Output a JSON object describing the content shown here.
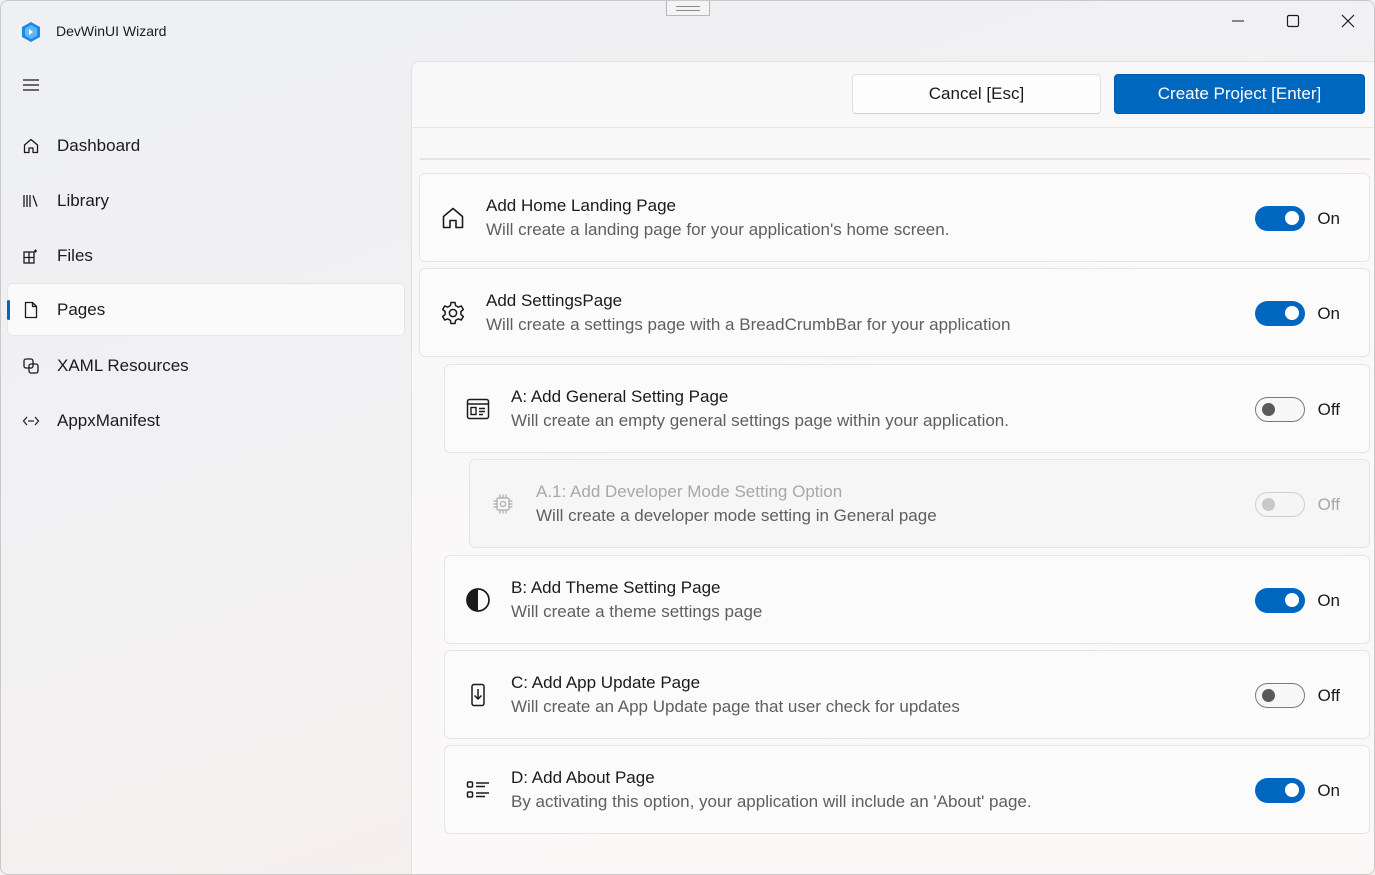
{
  "app": {
    "title": "DevWinUI Wizard",
    "accent": "#0067c0"
  },
  "sidebar": {
    "menu_icon": "hamburger-icon",
    "items": [
      {
        "label": "Dashboard",
        "icon": "home-icon",
        "selected": false
      },
      {
        "label": "Library",
        "icon": "library-icon",
        "selected": false
      },
      {
        "label": "Files",
        "icon": "files-icon",
        "selected": false
      },
      {
        "label": "Pages",
        "icon": "page-icon",
        "selected": true
      },
      {
        "label": "XAML Resources",
        "icon": "resources-icon",
        "selected": false
      },
      {
        "label": "AppxManifest",
        "icon": "code-icon",
        "selected": false
      }
    ]
  },
  "toolbar": {
    "cancel_label": "Cancel [Esc]",
    "create_label": "Create Project [Enter]"
  },
  "options": [
    {
      "title": "Add Home Landing Page",
      "description": "Will create a landing page for your application's home screen.",
      "icon": "home-icon",
      "state": "On",
      "enabled": true
    },
    {
      "title": "Add SettingsPage",
      "description": "Will create a settings page with a BreadCrumbBar for your application",
      "icon": "gear-icon",
      "state": "On",
      "enabled": true
    },
    {
      "title": "A: Add General Setting Page",
      "description": "Will create an empty general settings page within your application.",
      "icon": "panel-icon",
      "state": "Off",
      "enabled": true
    },
    {
      "title": "A.1: Add Developer Mode Setting Option",
      "description": "Will create a developer mode setting in General page",
      "icon": "chip-icon",
      "state": "Off",
      "enabled": false
    },
    {
      "title": "B: Add Theme Setting Page",
      "description": "Will create a theme settings page",
      "icon": "contrast-icon",
      "state": "On",
      "enabled": true
    },
    {
      "title": "C: Add App Update Page",
      "description": "Will create an App Update page that user check for updates",
      "icon": "download-icon",
      "state": "Off",
      "enabled": true
    },
    {
      "title": "D: Add About Page",
      "description": "By activating this option, your application will include an 'About' page.",
      "icon": "list-icon",
      "state": "On",
      "enabled": true
    }
  ]
}
